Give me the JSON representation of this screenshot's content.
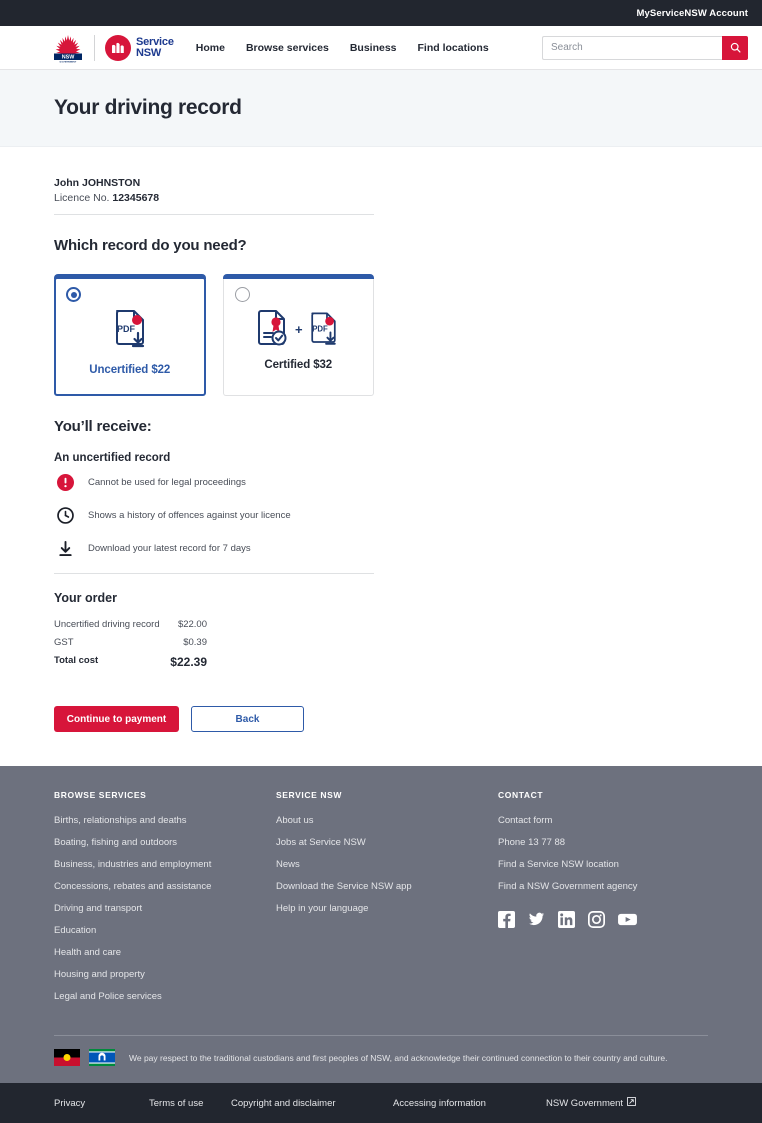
{
  "utility_bar": {
    "account_link": "MyServiceNSW Account"
  },
  "header": {
    "logo_nsw_alt": "NSW Government",
    "logo_service_line1": "Service",
    "logo_service_line2": "NSW",
    "nav": [
      {
        "label": "Home"
      },
      {
        "label": "Browse services"
      },
      {
        "label": "Business"
      },
      {
        "label": "Find locations"
      }
    ],
    "search": {
      "placeholder": "Search",
      "value": ""
    }
  },
  "page": {
    "title": "Your driving record"
  },
  "licence": {
    "name": "John JOHNSTON",
    "label": "Licence No.",
    "number": "12345678"
  },
  "record_choice": {
    "heading": "Which record do you need?",
    "options": [
      {
        "label": "Uncertified $22",
        "selected": true,
        "icon": "pdf-download-icon"
      },
      {
        "label": "Certified $32",
        "selected": false,
        "icon": "certificate-plus-pdf-icon"
      }
    ],
    "plus_symbol": "+"
  },
  "receive": {
    "heading": "You’ll receive:",
    "subheading": "An uncertified record",
    "items": [
      {
        "icon": "alert-icon",
        "text": "Cannot be used for legal proceedings"
      },
      {
        "icon": "clock-icon",
        "text": "Shows a history of offences against your licence"
      },
      {
        "icon": "download-icon",
        "text": "Download your latest record for 7 days"
      }
    ]
  },
  "order": {
    "heading": "Your order",
    "rows": [
      {
        "label": "Uncertified driving record",
        "value": "$22.00"
      },
      {
        "label": "GST",
        "value": "$0.39"
      }
    ],
    "total": {
      "label": "Total cost",
      "value": "$22.39"
    }
  },
  "actions": {
    "primary": "Continue to payment",
    "secondary": "Back"
  },
  "footer": {
    "columns": [
      {
        "heading": "BROWSE SERVICES",
        "links": [
          "Births, relationships and deaths",
          "Boating, fishing and outdoors",
          "Business, industries and employment",
          "Concessions, rebates and assistance",
          "Driving and transport",
          "Education",
          "Health and care",
          "Housing and property",
          "Legal and Police services"
        ]
      },
      {
        "heading": "SERVICE NSW",
        "links": [
          "About us",
          "Jobs at Service NSW",
          "News",
          "Download the Service NSW app",
          "Help in your language"
        ]
      },
      {
        "heading": "CONTACT",
        "links": [
          "Contact form",
          "Phone 13 77 88",
          "Find a Service NSW location",
          "Find a NSW Government agency"
        ]
      }
    ],
    "socials": [
      {
        "name": "facebook-icon"
      },
      {
        "name": "twitter-icon"
      },
      {
        "name": "linkedin-icon"
      },
      {
        "name": "instagram-icon"
      },
      {
        "name": "youtube-icon"
      }
    ],
    "acknowledgement": "We pay respect to the traditional custodians and first peoples of NSW, and acknowledge their continued connection to their country and culture.",
    "flags": [
      {
        "name": "aboriginal-flag"
      },
      {
        "name": "torres-strait-islander-flag"
      }
    ]
  },
  "bottom_bar": {
    "links": [
      {
        "label": "Privacy",
        "external": false
      },
      {
        "label": "Terms of use",
        "external": false
      },
      {
        "label": "Copyright and disclaimer",
        "external": false
      },
      {
        "label": "Accessing information",
        "external": false
      },
      {
        "label": "NSW Government",
        "external": true
      }
    ]
  },
  "colors": {
    "brand_red": "#d7153a",
    "brand_blue": "#2e5aa8",
    "dark": "#22262f",
    "footer_grey": "#6d717e",
    "band": "#f4f7f9"
  }
}
